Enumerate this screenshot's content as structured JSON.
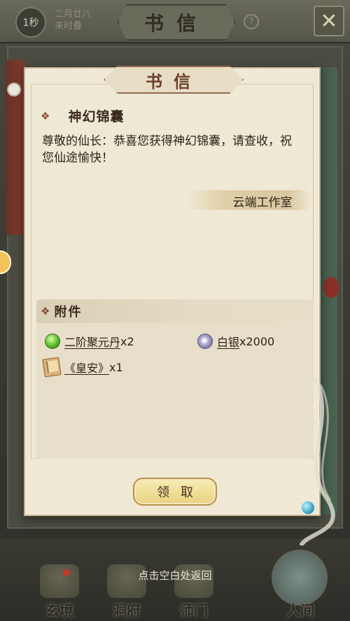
{
  "topbar": {
    "timer": "1秒",
    "date_line1": "二月廿八",
    "date_line2": "未时叠",
    "title": "书信",
    "help_icon": "?",
    "close_icon": "✕"
  },
  "letter": {
    "header": "书信",
    "subject": "神幻锦囊",
    "body": "尊敬的仙长：恭喜您获得神幻锦囊，请查收，祝您仙途愉快！",
    "signature": "云端工作室",
    "attachments_title": "附件",
    "attachments": [
      {
        "name": "二阶聚元丹",
        "qty": "x2",
        "icon": "green-pill-icon"
      },
      {
        "name": "白银",
        "qty": "x2000",
        "icon": "silver-coin-icon"
      },
      {
        "name": "《皇安》",
        "qty": "x1",
        "icon": "book-icon"
      }
    ],
    "claim_button": "领取"
  },
  "bottom": {
    "hint": "点击空白处返回",
    "nav": [
      "玄境",
      "洞府",
      "师门",
      "人间"
    ]
  },
  "colors": {
    "paper": "#efe9d6",
    "accent_brown": "#8b4a34",
    "button_gold": "#e8d27e"
  }
}
